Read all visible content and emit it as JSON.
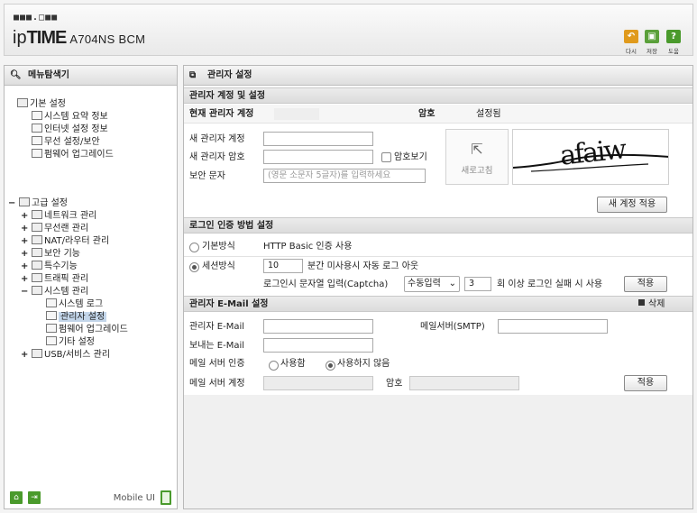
{
  "header": {
    "brand_dots": "■■■.□■■",
    "brand_ip": "ip",
    "brand_time": "TIME",
    "model": "A704NS BCM",
    "buttons": [
      {
        "label": "다시",
        "icon": "undo-icon",
        "color": "#e09a1c"
      },
      {
        "label": "저장",
        "icon": "save-icon",
        "color": "#5aa03a"
      },
      {
        "label": "도움",
        "icon": "help-icon",
        "color": "#4a9a2c"
      }
    ]
  },
  "left": {
    "title": "메뉴탐색기",
    "tree": {
      "basic": "기본 설정",
      "basic_items": [
        "시스템 요약 정보",
        "인터넷 설정 정보",
        "무선 설정/보안",
        "펌웨어 업그레이드"
      ],
      "advanced": "고급 설정",
      "advanced_items": [
        "네트워크 관리",
        "무선랜 관리",
        "NAT/라우터 관리",
        "보안 기능",
        "특수기능",
        "트래픽 관리",
        "시스템 관리"
      ],
      "system_items": [
        "시스템 로그",
        "관리자 설정",
        "펌웨어 업그레이드",
        "기타 설정"
      ],
      "usb": "USB/서비스 관리"
    },
    "mobile_label": "Mobile UI"
  },
  "right": {
    "title": "관리자 설정",
    "account": {
      "heading": "관리자 계정 및 설정",
      "current_label": "현재 관리자 계정",
      "password_label": "암호",
      "password_status": "설정됨",
      "new_account_label": "새 관리자 계정",
      "new_password_label": "새 관리자 암호",
      "show_password_label": "암호보기",
      "captcha_label": "보안 문자",
      "captcha_placeholder": "(영문 소문자 5글자)를 입력하세요",
      "refresh_label": "새로고침",
      "captcha_text": "afaiw",
      "apply_button": "새 계정 적용"
    },
    "login": {
      "heading": "로그인 인증 방법 설정",
      "basic_label": "기본방식",
      "basic_desc": "HTTP Basic 인증 사용",
      "session_label": "세션방식",
      "session_minutes": "10",
      "session_desc": "분간 미사용시 자동 로그 아웃",
      "captcha_desc": "로그인시 문자열 입력(Captcha)",
      "captcha_mode": "수동입력",
      "fail_count": "3",
      "fail_desc": "회 이상 로그인 실패 시 사용",
      "apply_button": "적용"
    },
    "email": {
      "heading": "관리자 E-Mail 설정",
      "delete_label": "삭제",
      "admin_email_label": "관리자 E-Mail",
      "smtp_label": "메일서버(SMTP)",
      "sender_label": "보내는 E-Mail",
      "auth_label": "메일 서버 인증",
      "auth_use": "사용함",
      "auth_nouse": "사용하지 않음",
      "account_label": "메일 서버 계정",
      "password_label": "암호",
      "apply_button": "적용"
    }
  }
}
